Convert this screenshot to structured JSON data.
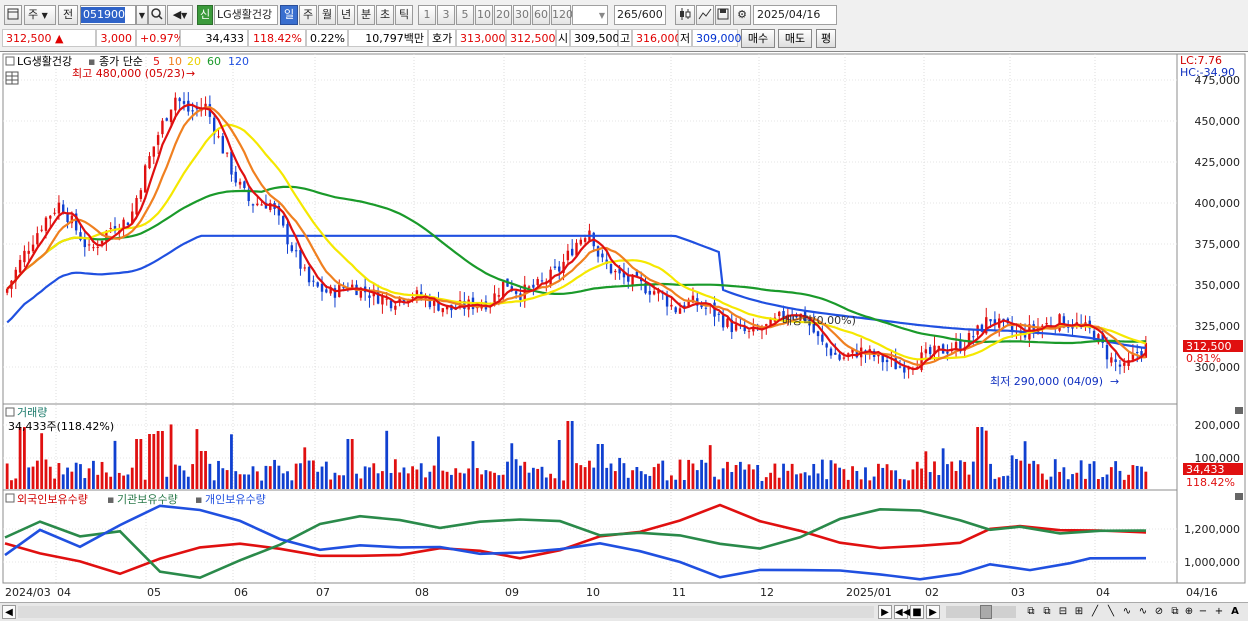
{
  "toolbar": {
    "market": "주",
    "prev": "전",
    "code": "051900",
    "credit_badge": "신",
    "stock_name": "LG생활건강",
    "period_tabs": [
      "일",
      "주",
      "월",
      "년",
      "분",
      "초",
      "틱"
    ],
    "active_period": "일",
    "minute_buttons": [
      "1",
      "3",
      "5",
      "10",
      "20",
      "30",
      "60",
      "120"
    ],
    "count": "265",
    "count_total": "/600",
    "date": "2025/04/16"
  },
  "info": {
    "price": "312,500",
    "change_arrow": "▲",
    "change": "3,000",
    "change_pct": "+0.97%",
    "volume": "34,433",
    "volume_ratio": "118.42%",
    "turnover": "0.22%",
    "amount": "10,797백만",
    "quote_label": "호가",
    "ask": "313,000",
    "bid": "312,500",
    "open_label": "시",
    "open": "309,500",
    "high_label": "고",
    "high": "316,000",
    "low_label": "저",
    "low": "309,000",
    "buy": "매수",
    "sell": "매도",
    "eval": "평"
  },
  "price_pane": {
    "title": "LG생활건강",
    "ma_label": "종가 단순",
    "ma_periods": [
      "5",
      "10",
      "20",
      "60",
      "120"
    ],
    "ma_colors": [
      "#e01010",
      "#f08020",
      "#f0e000",
      "#1a9a2a",
      "#2050e0"
    ],
    "high_note": "최고 480,000 (05/23)",
    "low_note": "최저 290,000 (04/09)",
    "dividend_note": "배당락(0.00%)",
    "lc": "LC:7.76",
    "hc": "HC:-34.90",
    "y_ticks": [
      "475,000",
      "450,000",
      "425,000",
      "400,000",
      "375,000",
      "350,000",
      "325,000",
      "300,000"
    ],
    "last_price_tag": "312,500",
    "last_pct_tag": "0.81%"
  },
  "volume_pane": {
    "title": "거래량",
    "value_note": "34,433주(118.42%)",
    "y_ticks": [
      "200,000",
      "100,000"
    ],
    "last_tag": "34,433",
    "last_pct_tag": "118.42%"
  },
  "holder_pane": {
    "legend": [
      "외국인보유수량",
      "기관보유수량",
      "개인보유수량"
    ],
    "colors": [
      "#e01010",
      "#2a8a4a",
      "#2050e0"
    ],
    "y_ticks": [
      "1,200,000",
      "1,000,000"
    ]
  },
  "x_axis": [
    "2024/03",
    "04",
    "05",
    "06",
    "07",
    "08",
    "09",
    "10",
    "11",
    "12",
    "2025/01",
    "02",
    "03",
    "04",
    "04/16"
  ],
  "chart_data": {
    "type": "line",
    "title": "LG생활건강",
    "x": [
      "2024/03",
      "04",
      "05",
      "06",
      "07",
      "08",
      "09",
      "10",
      "11",
      "12",
      "2025/01",
      "02",
      "03",
      "04"
    ],
    "series": [
      {
        "name": "종가",
        "values": [
          345000,
          395000,
          455000,
          405000,
          345000,
          340000,
          350000,
          380000,
          340000,
          325000,
          300000,
          310000,
          325000,
          312500
        ]
      },
      {
        "name": "120",
        "values": [
          345000,
          338000,
          345000,
          365000,
          372000,
          376000,
          378000,
          375000,
          355000,
          345000,
          335000,
          330000,
          325000,
          322000
        ]
      }
    ],
    "ylim": [
      290000,
      480000
    ]
  }
}
